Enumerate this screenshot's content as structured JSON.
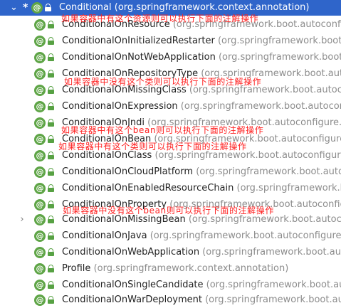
{
  "tree": {
    "root": {
      "name": "Conditional",
      "package": "(org.springframework.context.annotation)"
    },
    "items": [
      {
        "name": "ConditionalOnResource",
        "package": "(org.springframework.boot.autoconfigure.condition)"
      },
      {
        "name": "ConditionalOnInitializedRestarter",
        "package": "(org.springframework.boot.devtools.restart)"
      },
      {
        "name": "ConditionalOnNotWebApplication",
        "package": "(org.springframework.boot.autoconfigure.condition)"
      },
      {
        "name": "ConditionalOnRepositoryType",
        "package": "(org.springframework.boot.autoconfigure.data)"
      },
      {
        "name": "ConditionalOnMissingClass",
        "package": "(org.springframework.boot.autoconfigure.condition)"
      },
      {
        "name": "ConditionalOnExpression",
        "package": "(org.springframework.boot.autoconfigure.condition)"
      },
      {
        "name": "ConditionalOnJndi",
        "package": "(org.springframework.boot.autoconfigure.condition)"
      },
      {
        "name": "ConditionalOnBean",
        "package": "(org.springframework.boot.autoconfigure.condition)"
      },
      {
        "name": "ConditionalOnClass",
        "package": "(org.springframework.boot.autoconfigure.condition)"
      },
      {
        "name": "ConditionalOnCloudPlatform",
        "package": "(org.springframework.boot.autoconfigure.condition)"
      },
      {
        "name": "ConditionalOnEnabledResourceChain",
        "package": "(org.springframework.boot.autoconfigure.web)"
      },
      {
        "name": "ConditionalOnProperty",
        "package": "(org.springframework.boot.autoconfigure.condition)"
      },
      {
        "name": "ConditionalOnMissingBean",
        "package": "(org.springframework.boot.autoconfigure.condition)"
      },
      {
        "name": "ConditionalOnJava",
        "package": "(org.springframework.boot.autoconfigure.condition)"
      },
      {
        "name": "ConditionalOnWebApplication",
        "package": "(org.springframework.boot.autoconfigure.condition)"
      },
      {
        "name": "Profile",
        "package": "(org.springframework.context.annotation)"
      },
      {
        "name": "ConditionalOnSingleCandidate",
        "package": "(org.springframework.boot.autoconfigure.condition)"
      },
      {
        "name": "ConditionalOnWarDeployment",
        "package": "(org.springframework.boot.autoconfigure.condition)"
      }
    ]
  },
  "annotations": {
    "resource": "如果容器中有这个资源则可以执行下面的注解操作",
    "missing_class": "如果容器中没有这个类则可以执行下面的注解操作",
    "bean": "如果容器中有这个bean则可以执行下面的注解操作",
    "class": "如果容器中有这个类则可以执行下面的注解操作",
    "missing_bean": "如果容器中没有这个bean则可以执行下面的注解操作"
  },
  "icons": {
    "selected_marker": "*",
    "annotation_icon_text": "@",
    "collapsed_arrow": "›"
  },
  "colors": {
    "selection": "#2f65ca",
    "annotation_icon": "#5fa547",
    "package_text": "#8c8c8c",
    "note_text": "#ff2020"
  }
}
